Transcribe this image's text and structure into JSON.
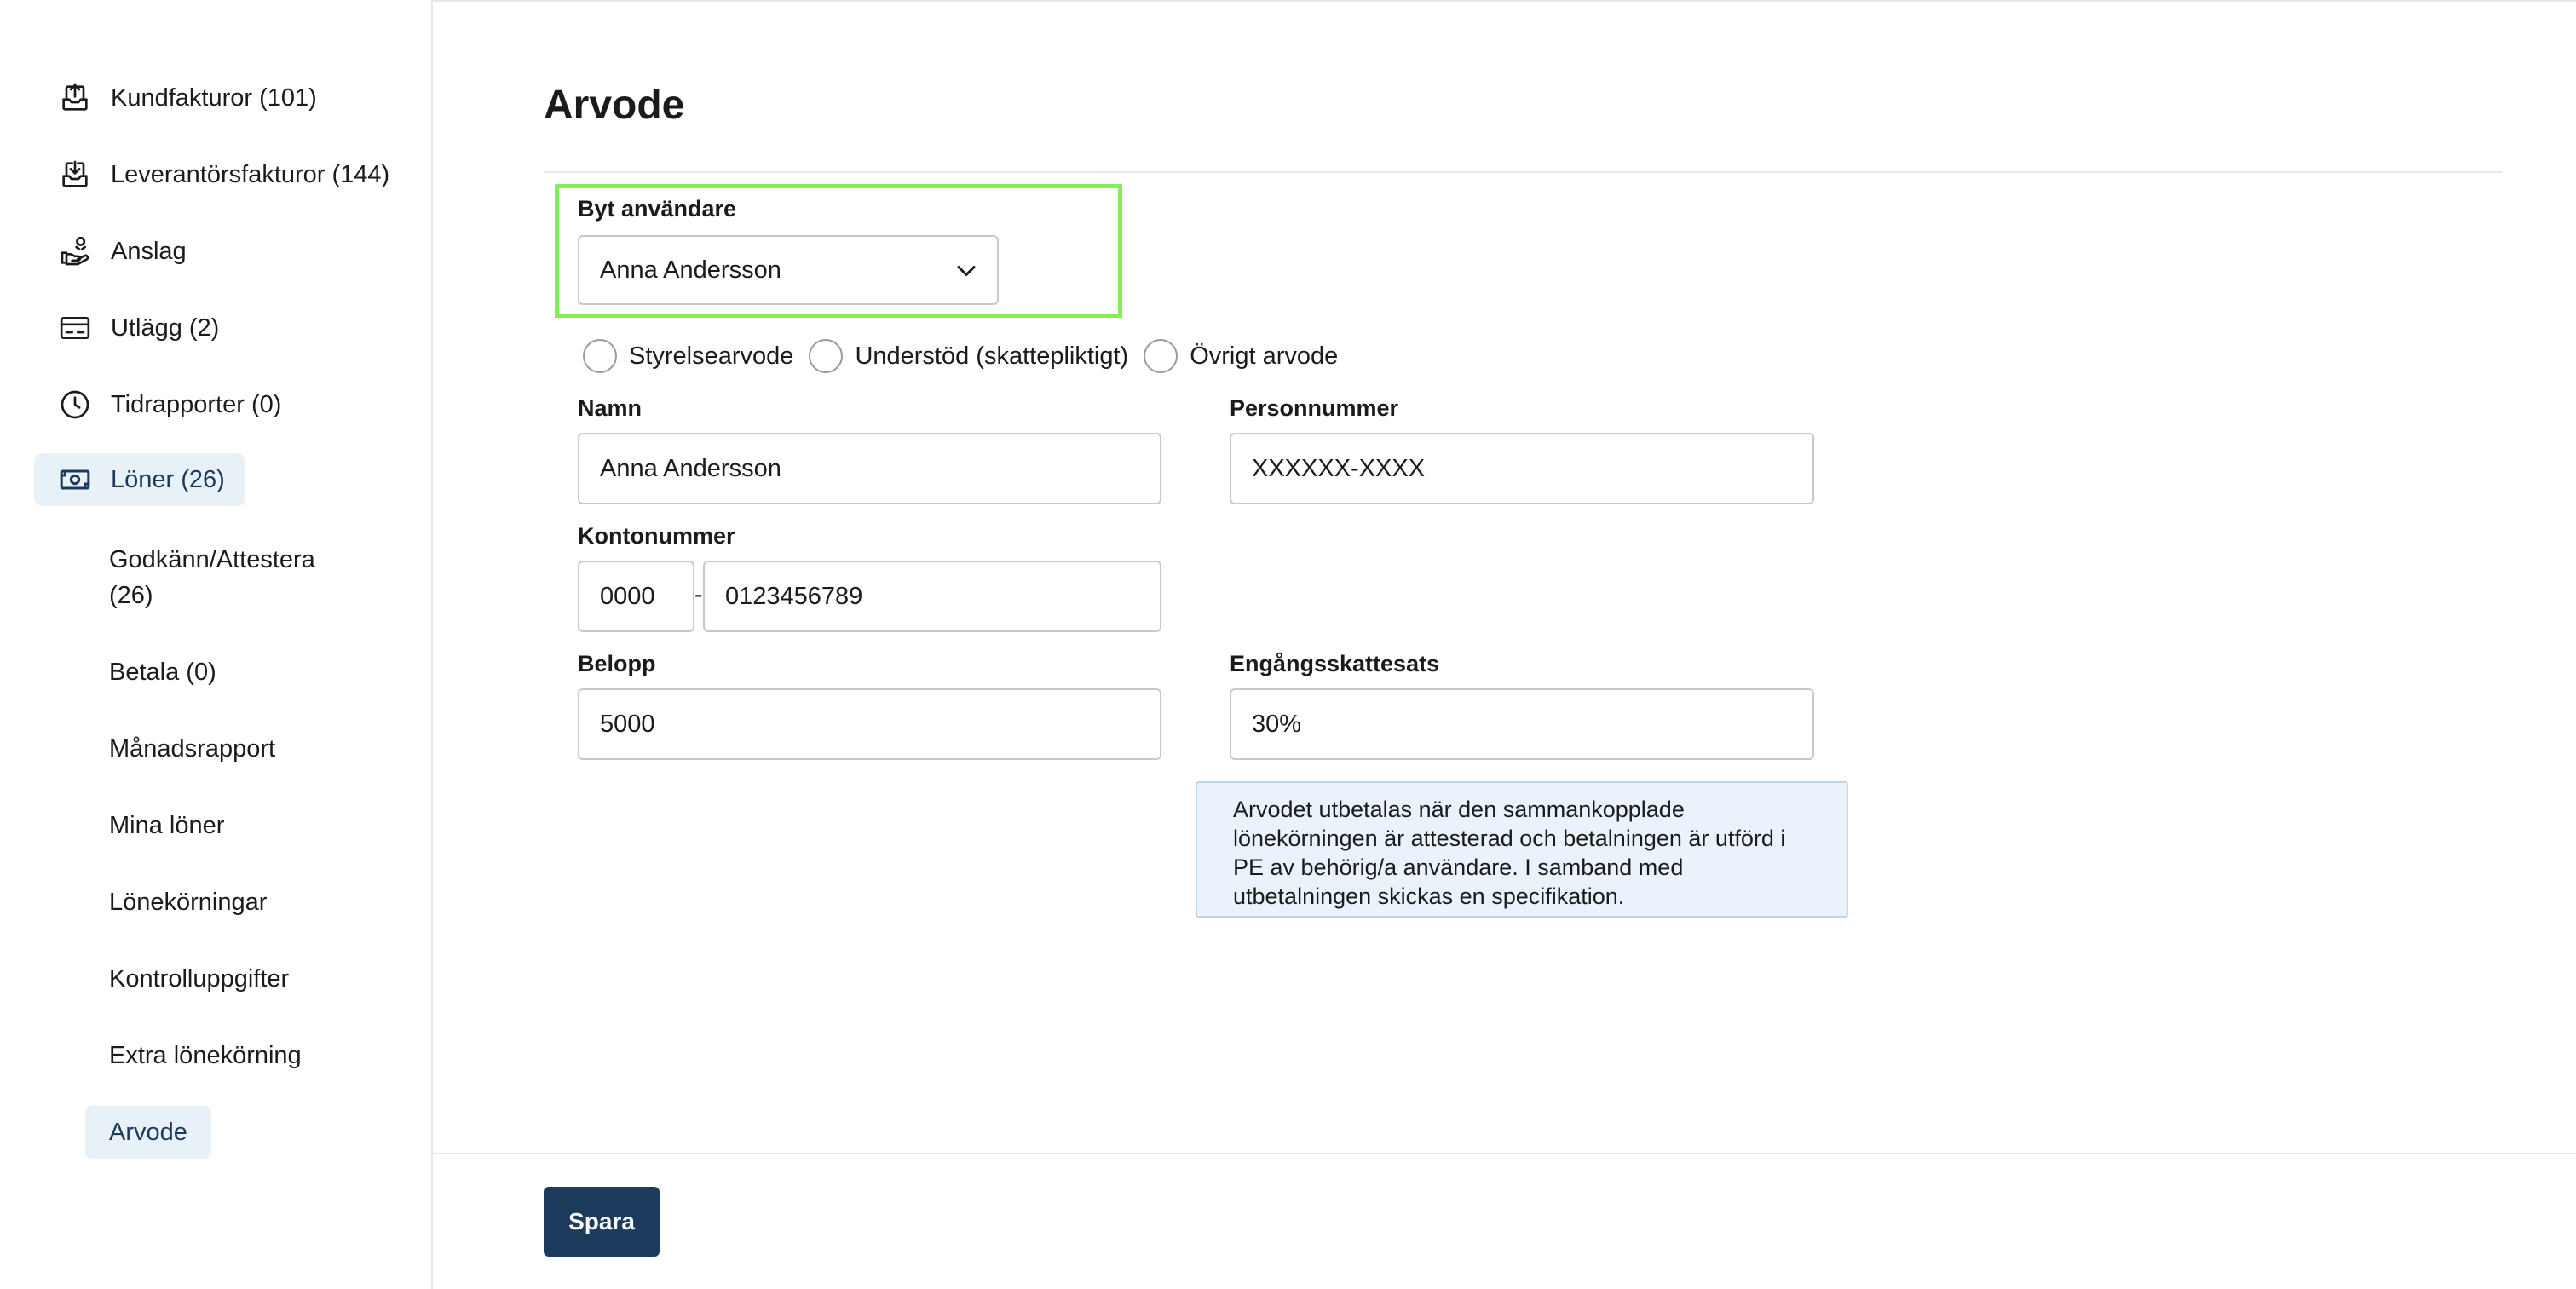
{
  "sidebar": {
    "items": [
      {
        "label": "Kundfakturor (101)",
        "icon": "outbox-upload-icon"
      },
      {
        "label": "Leverantörsfakturor (144)",
        "icon": "inbox-download-icon"
      },
      {
        "label": "Anslag",
        "icon": "hand-coin-icon"
      },
      {
        "label": "Utlägg (2)",
        "icon": "card-icon"
      },
      {
        "label": "Tidrapporter (0)",
        "icon": "clock-icon"
      },
      {
        "label": "Löner (26)",
        "icon": "banknote-icon",
        "active": true
      }
    ],
    "sub_items": [
      {
        "label_line1": "Godkänn/Attestera",
        "label_line2": "(26)"
      },
      {
        "label": "Betala (0)"
      },
      {
        "label": "Månadsrapport"
      },
      {
        "label": "Mina löner"
      },
      {
        "label": "Lönekörningar"
      },
      {
        "label": "Kontrolluppgifter"
      },
      {
        "label": "Extra lönekörning"
      },
      {
        "label": "Arvode",
        "active": true
      }
    ]
  },
  "main": {
    "title": "Arvode",
    "switch_user": {
      "label": "Byt användare",
      "selected": "Anna Andersson"
    },
    "radios": [
      "Styrelsearvode",
      "Understöd (skattepliktigt)",
      "Övrigt arvode"
    ],
    "name": {
      "label": "Namn",
      "value": "Anna Andersson"
    },
    "personnummer": {
      "label": "Personnummer",
      "value": "XXXXXX-XXXX"
    },
    "account": {
      "label": "Kontonummer",
      "clearing": "0000",
      "separator": "-",
      "number": "0123456789"
    },
    "amount": {
      "label": "Belopp",
      "value": "5000"
    },
    "tax_rate": {
      "label": "Engångsskattesats",
      "value": "30%"
    },
    "info_lines": [
      "Arvodet utbetalas när den sammankopplade",
      "lönekörningen är attesterad och betalningen är utförd i",
      "PE av behörig/a användare. I samband med",
      "utbetalningen skickas en specifikation."
    ]
  },
  "footer": {
    "save_label": "Spara"
  },
  "colors": {
    "accent": "#1d3c5d",
    "active_bg": "#e9f1f8",
    "highlight": "#86ee55",
    "info_bg": "#eaf3fb"
  }
}
